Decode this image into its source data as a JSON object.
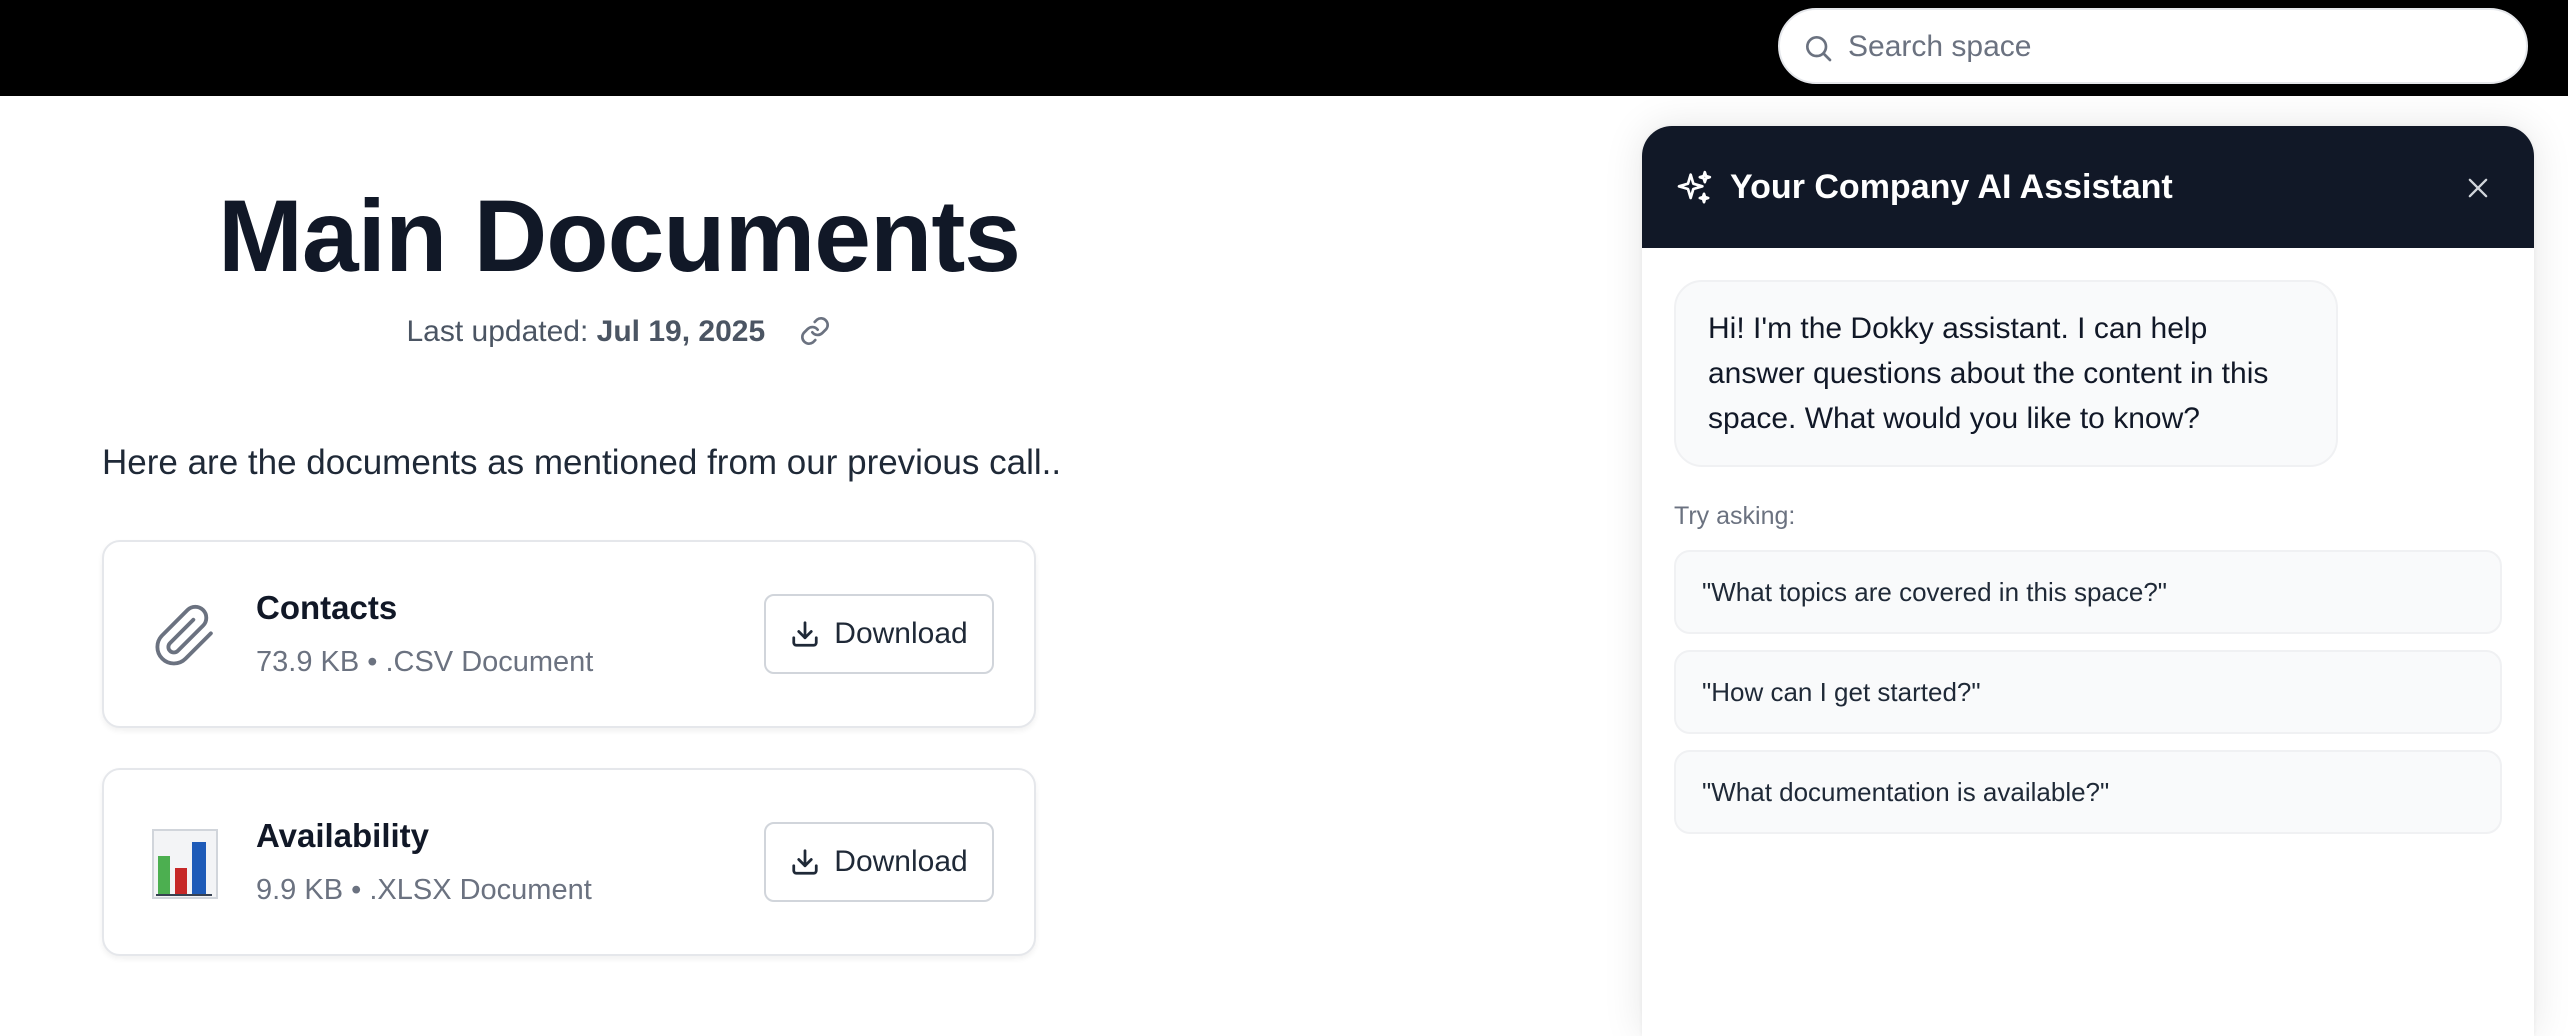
{
  "search": {
    "placeholder": "Search space"
  },
  "page": {
    "title": "Main Documents",
    "updated_label": "Last updated:",
    "updated_date": "Jul 19, 2025",
    "intro": "Here are the documents as mentioned from our previous call.."
  },
  "files": [
    {
      "name": "Contacts",
      "meta": "73.9 KB • .CSV Document",
      "icon": "paperclip-icon",
      "download_label": "Download"
    },
    {
      "name": "Availability",
      "meta": "9.9 KB • .XLSX Document",
      "icon": "spreadsheet-chart-icon",
      "download_label": "Download"
    }
  ],
  "assistant": {
    "title": "Your Company AI Assistant",
    "greeting": "Hi! I'm the Dokky assistant. I can help answer questions about the content in this space. What would you like to know?",
    "try_label": "Try asking:",
    "suggestions": [
      "\"What topics are covered in this space?\"",
      "\"How can I get started?\"",
      "\"What documentation is available?\""
    ]
  },
  "colors": {
    "topbar": "#000000",
    "header": "#111827",
    "text": "#111827",
    "muted": "#6b7280",
    "card_border": "#e5e7eb"
  }
}
